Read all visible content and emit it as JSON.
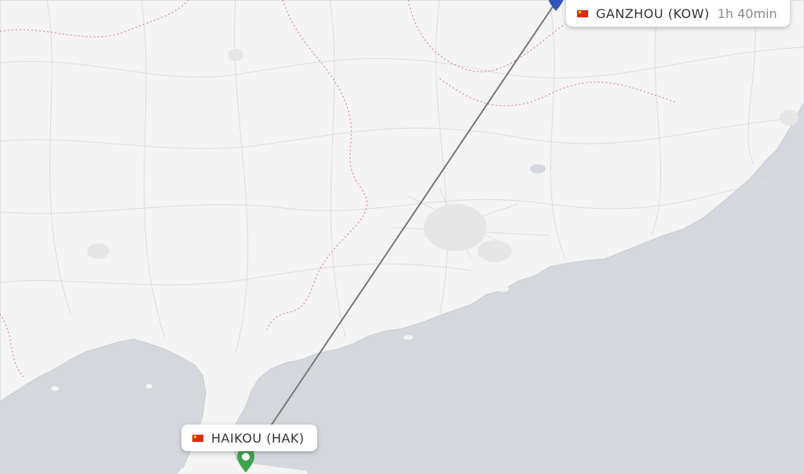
{
  "map": {
    "origin": {
      "label": "HAIKOU (HAK)",
      "country": "China",
      "flag_icon": "china-flag-icon",
      "pin_color": "#3fa34d"
    },
    "destination": {
      "label": "GANZHOU (KOW)",
      "duration": "1h 40min",
      "country": "China",
      "flag_icon": "china-flag-icon",
      "pin_color": "#2f55b8"
    },
    "colors": {
      "land": "#f4f4f4",
      "sea": "#d4d8dc",
      "route": "#777777",
      "border": "#d98c8c"
    }
  }
}
